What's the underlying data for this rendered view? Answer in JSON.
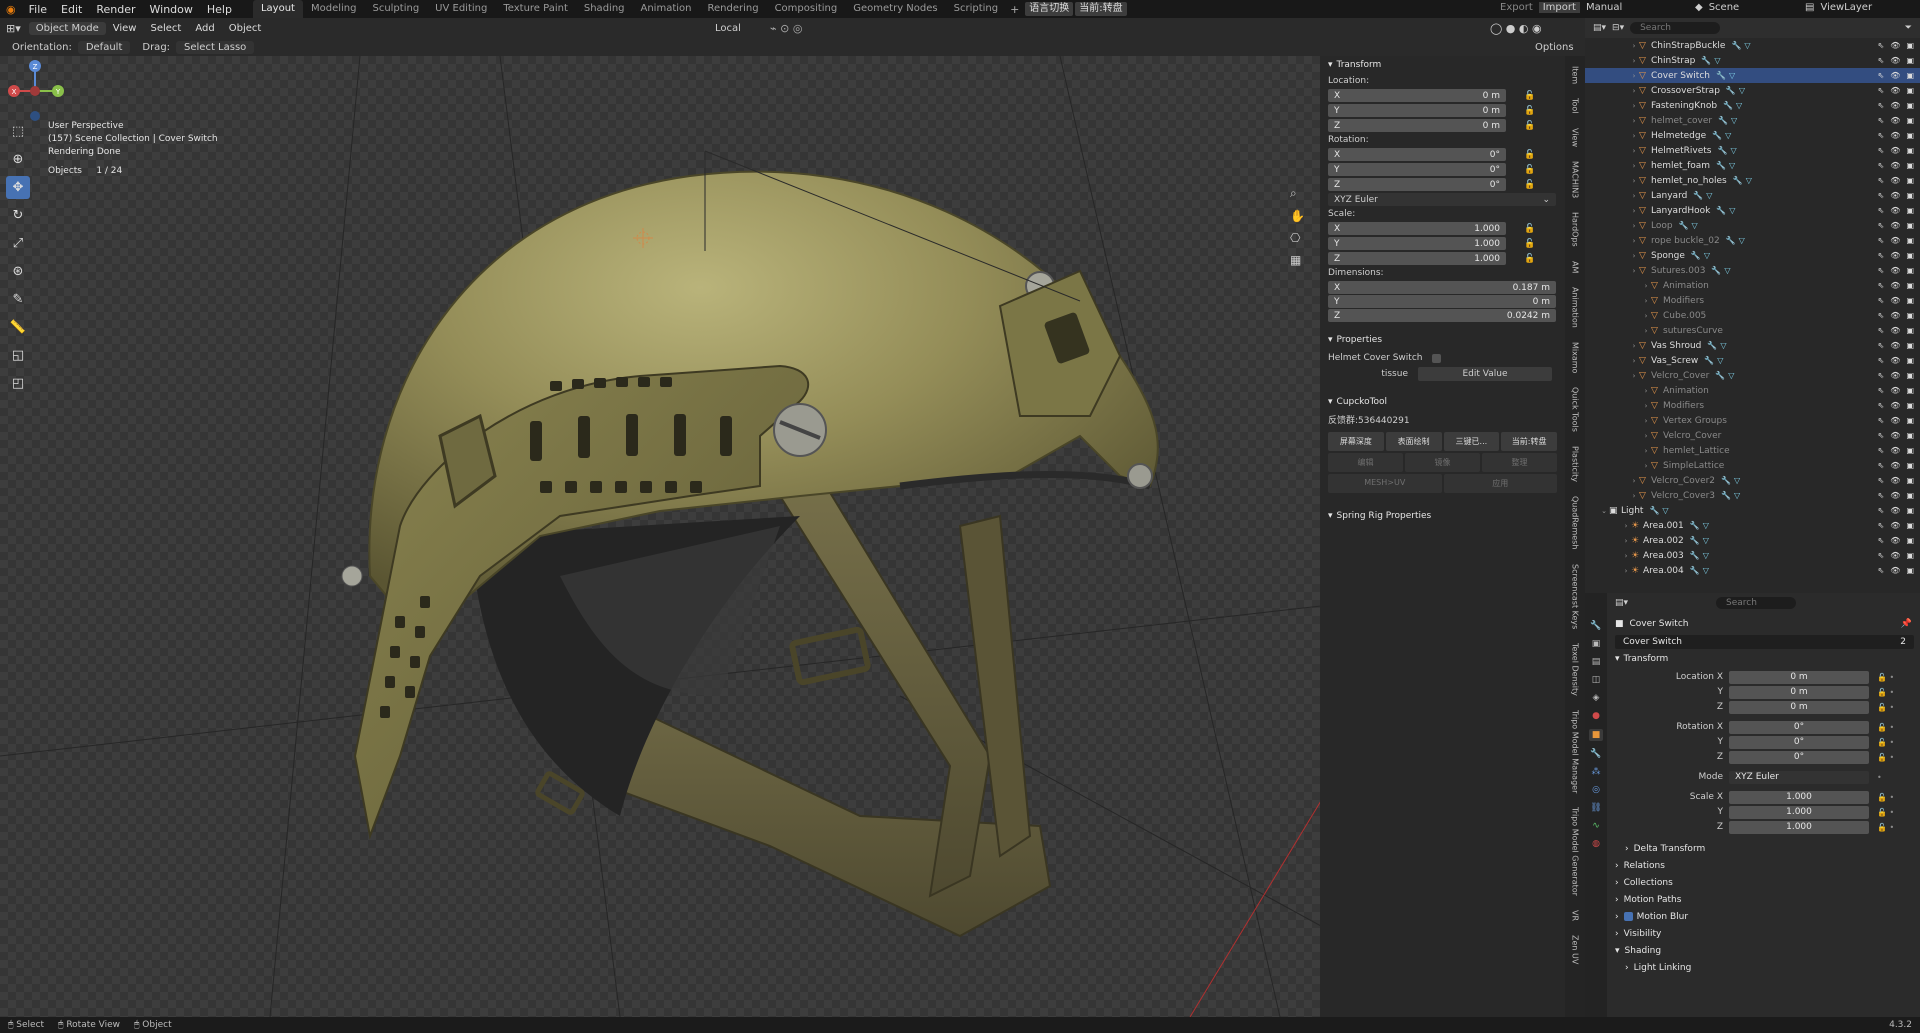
{
  "topbar": {
    "menus": [
      "File",
      "Edit",
      "Render",
      "Window",
      "Help"
    ],
    "workspaces": [
      "Layout",
      "Modeling",
      "Sculpting",
      "UV Editing",
      "Texture Paint",
      "Shading",
      "Animation",
      "Rendering",
      "Compositing",
      "Geometry Nodes",
      "Scripting"
    ],
    "active_workspace": "Layout",
    "lang_pills": [
      "语言切换",
      "当前:转盘"
    ],
    "export": "Export",
    "import": "Import",
    "manual": "Manual",
    "scene": "Scene",
    "viewlayer": "ViewLayer"
  },
  "viewport_header": {
    "mode": "Object Mode",
    "menus": [
      "View",
      "Select",
      "Add",
      "Object"
    ],
    "transform_space": "Local",
    "orientation_label": "Orientation:",
    "orientation_value": "Default",
    "drag_label": "Drag:",
    "drag_value": "Select Lasso",
    "options": "Options"
  },
  "viewport_info": {
    "line1": "User Perspective",
    "line2": "(157) Scene Collection | Cover Switch",
    "line3": "Rendering Done",
    "objects_label": "Objects",
    "objects_value": "1 / 24"
  },
  "gizmo": {
    "x": "X",
    "y": "Y",
    "z": "Z"
  },
  "npanel": {
    "transform_title": "Transform",
    "location_label": "Location:",
    "location": [
      {
        "axis": "X",
        "value": "0 m"
      },
      {
        "axis": "Y",
        "value": "0 m"
      },
      {
        "axis": "Z",
        "value": "0 m"
      }
    ],
    "rotation_label": "Rotation:",
    "rotation": [
      {
        "axis": "X",
        "value": "0°"
      },
      {
        "axis": "Y",
        "value": "0°"
      },
      {
        "axis": "Z",
        "value": "0°"
      }
    ],
    "rotation_mode": "XYZ Euler",
    "scale_label": "Scale:",
    "scale": [
      {
        "axis": "X",
        "value": "1.000"
      },
      {
        "axis": "Y",
        "value": "1.000"
      },
      {
        "axis": "Z",
        "value": "1.000"
      }
    ],
    "dimensions_label": "Dimensions:",
    "dimensions": [
      {
        "axis": "X",
        "value": "0.187 m"
      },
      {
        "axis": "Y",
        "value": "0 m"
      },
      {
        "axis": "Z",
        "value": "0.0242 m"
      }
    ],
    "properties_title": "Properties",
    "helmet_cover_switch": "Helmet Cover Switch",
    "tissue_label": "tissue",
    "edit_value": "Edit Value",
    "cupcko_title": "CupckoTool",
    "feedback": "反馈群:536440291",
    "cupcko_row1": [
      "屏幕深度",
      "表面绘制",
      "三键已...",
      "当前:转盘"
    ],
    "cupcko_row2": [
      "编辑",
      "镜像",
      "整理"
    ],
    "cupcko_row3": [
      "MESH>UV",
      "应用"
    ],
    "spring_title": "Spring Rig Properties",
    "tabs": [
      "Item",
      "Tool",
      "View",
      "MACHIN3",
      "HardOps",
      "AM",
      "Animation",
      "Mixamo",
      "Quick Tools",
      "Plasticity",
      "QuadRemesh",
      "Screencast Keys",
      "Texel Density",
      "Tripo Model Manager",
      "Tripo Model Generator",
      "VR",
      "Zen UV"
    ]
  },
  "outliner": {
    "search_placeholder": "Search",
    "items": [
      {
        "name": "ChinStrapBuckle",
        "dim": false,
        "sel": false
      },
      {
        "name": "ChinStrap",
        "dim": false,
        "sel": false
      },
      {
        "name": "Cover Switch",
        "dim": false,
        "sel": true
      },
      {
        "name": "CrossoverStrap",
        "dim": false,
        "sel": false
      },
      {
        "name": "FasteningKnob",
        "dim": false,
        "sel": false
      },
      {
        "name": "helmet_cover",
        "dim": true,
        "sel": false
      },
      {
        "name": "Helmetedge",
        "dim": false,
        "sel": false
      },
      {
        "name": "HelmetRivets",
        "dim": false,
        "sel": false
      },
      {
        "name": "hemlet_foam",
        "dim": false,
        "sel": false
      },
      {
        "name": "hemlet_no_holes",
        "dim": false,
        "sel": false
      },
      {
        "name": "Lanyard",
        "dim": false,
        "sel": false
      },
      {
        "name": "LanyardHook",
        "dim": false,
        "sel": false
      },
      {
        "name": "Loop",
        "dim": true,
        "sel": false
      },
      {
        "name": "rope buckle_02",
        "dim": true,
        "sel": false
      },
      {
        "name": "Sponge",
        "dim": false,
        "sel": false
      },
      {
        "name": "Sutures.003",
        "dim": true,
        "sel": false
      },
      {
        "name": "Animation",
        "dim": true,
        "sel": false,
        "indent": 2
      },
      {
        "name": "Modifiers",
        "dim": true,
        "sel": false,
        "indent": 2
      },
      {
        "name": "Cube.005",
        "dim": true,
        "sel": false,
        "indent": 2
      },
      {
        "name": "suturesCurve",
        "dim": true,
        "sel": false,
        "indent": 2
      },
      {
        "name": "Vas Shroud",
        "dim": false,
        "sel": false
      },
      {
        "name": "Vas_Screw",
        "dim": false,
        "sel": false
      },
      {
        "name": "Velcro_Cover",
        "dim": true,
        "sel": false
      },
      {
        "name": "Animation",
        "dim": true,
        "sel": false,
        "indent": 2
      },
      {
        "name": "Modifiers",
        "dim": true,
        "sel": false,
        "indent": 2
      },
      {
        "name": "Vertex Groups",
        "dim": true,
        "sel": false,
        "indent": 2
      },
      {
        "name": "Velcro_Cover",
        "dim": true,
        "sel": false,
        "indent": 2
      },
      {
        "name": "hemlet_Lattice",
        "dim": true,
        "sel": false,
        "indent": 2
      },
      {
        "name": "SimpleLattice",
        "dim": true,
        "sel": false,
        "indent": 2
      },
      {
        "name": "Velcro_Cover2",
        "dim": true,
        "sel": false
      },
      {
        "name": "Velcro_Cover3",
        "dim": true,
        "sel": false
      },
      {
        "name": "Light",
        "dim": false,
        "sel": false,
        "collection": true
      },
      {
        "name": "Area.001",
        "dim": false,
        "sel": false,
        "light": true
      },
      {
        "name": "Area.002",
        "dim": false,
        "sel": false,
        "light": true
      },
      {
        "name": "Area.003",
        "dim": false,
        "sel": false,
        "light": true
      },
      {
        "name": "Area.004",
        "dim": false,
        "sel": false,
        "light": true
      }
    ]
  },
  "properties": {
    "search_placeholder": "Search",
    "object_title": "Cover Switch",
    "object_name": "Cover Switch",
    "users": "2",
    "transform_title": "Transform",
    "rows": [
      {
        "label": "Location X",
        "value": "0 m"
      },
      {
        "label": "Y",
        "value": "0 m"
      },
      {
        "label": "Z",
        "value": "0 m"
      },
      {
        "label": "Rotation X",
        "value": "0°"
      },
      {
        "label": "Y",
        "value": "0°"
      },
      {
        "label": "Z",
        "value": "0°"
      },
      {
        "label": "Mode",
        "value": "XYZ Euler"
      },
      {
        "label": "Scale X",
        "value": "1.000"
      },
      {
        "label": "Y",
        "value": "1.000"
      },
      {
        "label": "Z",
        "value": "1.000"
      }
    ],
    "sections": [
      "Delta Transform",
      "Relations",
      "Collections",
      "Motion Paths",
      "Motion Blur",
      "Visibility",
      "Shading",
      "Light Linking"
    ]
  },
  "statusbar": {
    "select": "Select",
    "rotate": "Rotate View",
    "object": "Object",
    "version": "4.3.2"
  },
  "colors": {
    "accent": "#4772b3",
    "selection": "#334d80",
    "helmet": "#8f8a52",
    "strap": "#6b6440"
  }
}
